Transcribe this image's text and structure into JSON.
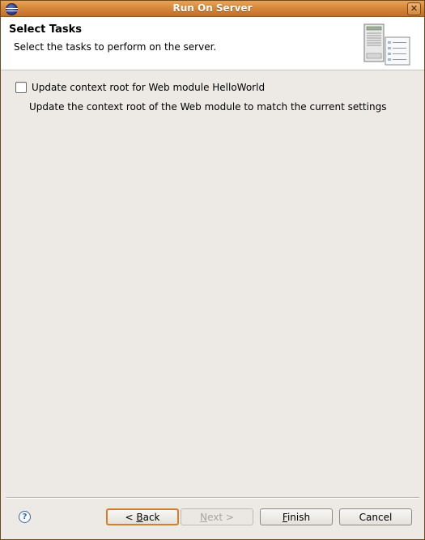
{
  "window": {
    "title": "Run On Server",
    "close_glyph": "✕"
  },
  "banner": {
    "title": "Select Tasks",
    "description": "Select the tasks to perform on the server.",
    "graphic_icon": "server-wizard-banner-icon"
  },
  "tasks": [
    {
      "checked": false,
      "label": "Update context root for Web module HelloWorld",
      "description": "Update the context root of the Web module to match the current settings"
    }
  ],
  "footer": {
    "help_glyph": "?",
    "back": {
      "pre": "< ",
      "mnemonic": "B",
      "post": "ack",
      "enabled": true,
      "default": true
    },
    "next": {
      "pre": "",
      "mnemonic": "N",
      "post": "ext >",
      "enabled": false
    },
    "finish": {
      "pre": "",
      "mnemonic": "F",
      "post": "inish",
      "enabled": true
    },
    "cancel": {
      "label": "Cancel",
      "enabled": true
    }
  },
  "colors": {
    "titlebar": "#d7883a",
    "dialog_bg": "#edeae5",
    "default_button_border": "#d47f2a"
  }
}
